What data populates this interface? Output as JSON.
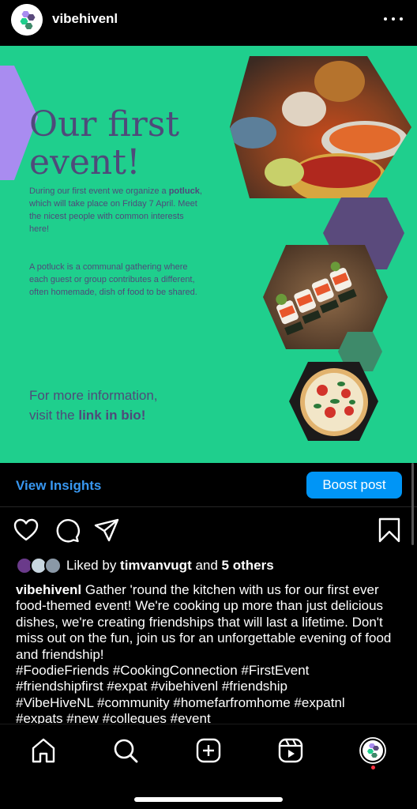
{
  "header": {
    "username": "vibehivenl",
    "avatar_icon": "vibehive-logo-icon",
    "more_icon": "more-dots-icon"
  },
  "post": {
    "title_line1": "Our first",
    "title_line2": "event!",
    "p1_before": "During our first event we organize a ",
    "p1_bold": "potluck",
    "p1_after": ", which will take place on Friday 7 April. Meet the nicest people with common interests here!",
    "p2": "A potluck is a communal gathering where each guest or group contributes a different, often homemade, dish of food to be shared.",
    "info_line1": "For more information,",
    "info_line2_before": "visit the ",
    "info_line2_bold": "link in bio!",
    "colors": {
      "background": "#1fcf8d",
      "text": "#4f4a7a",
      "hex_purple": "#5a4a7c",
      "hex_lavender": "#a98cf0",
      "hex_green": "#3e8a6a"
    }
  },
  "insights": {
    "view_label": "View Insights",
    "boost_label": "Boost post"
  },
  "actions": {
    "like_icon": "heart-icon",
    "comment_icon": "comment-icon",
    "share_icon": "send-icon",
    "save_icon": "bookmark-icon"
  },
  "likes": {
    "prefix": "Liked by ",
    "user": "timvanvugt",
    "middle": " and ",
    "others": "5 others"
  },
  "caption": {
    "username": "vibehivenl",
    "text": " Gather 'round the kitchen with us for our first ever food-themed event! We're cooking up more than just delicious dishes, we're creating friendships that will last a lifetime. Don't miss out on the fun, join us for an unforgettable evening of food and friendship!",
    "hashtags_line1": "#FoodieFriends #CookingConnection #FirstEvent",
    "hashtags_line2": "#friendshipfirst #expat #vibehivenl #friendship",
    "hashtags_line3": "#VibeHiveNL #community #homefarfromhome #expatnl",
    "hashtags_line4": "#expats #new #colleques #event"
  },
  "nav": {
    "home_icon": "home-icon",
    "search_icon": "search-icon",
    "create_icon": "create-post-icon",
    "reels_icon": "reels-icon",
    "profile_icon": "profile-avatar-icon"
  }
}
